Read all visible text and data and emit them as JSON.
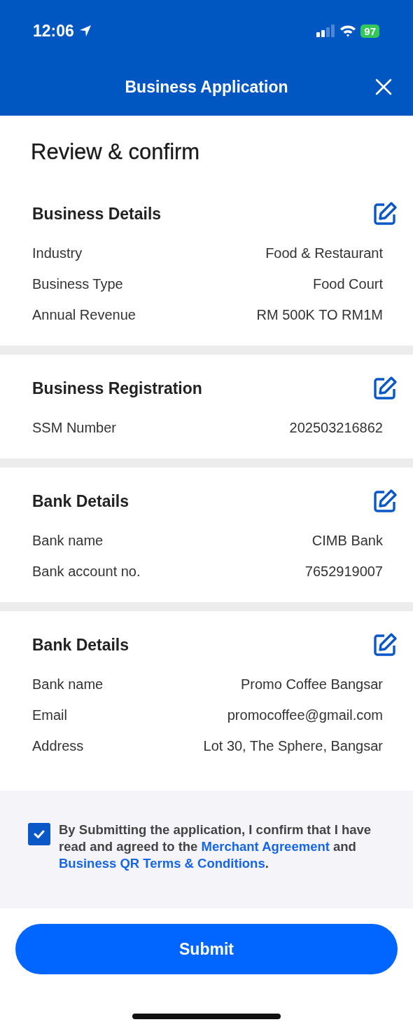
{
  "status_bar": {
    "time": "12:06",
    "battery": "97"
  },
  "header": {
    "title": "Business Application"
  },
  "page_title": "Review & confirm",
  "sections": [
    {
      "title": "Business Details",
      "rows": [
        {
          "label": "Industry",
          "value": "Food & Restaurant"
        },
        {
          "label": "Business Type",
          "value": "Food Court"
        },
        {
          "label": "Annual Revenue",
          "value": "RM 500K TO RM1M"
        }
      ]
    },
    {
      "title": "Business Registration",
      "rows": [
        {
          "label": "SSM Number",
          "value": "202503216862"
        }
      ]
    },
    {
      "title": "Bank Details",
      "rows": [
        {
          "label": "Bank name",
          "value": "CIMB Bank"
        },
        {
          "label": "Bank account no.",
          "value": "7652919007"
        }
      ]
    },
    {
      "title": "Bank Details",
      "rows": [
        {
          "label": "Bank name",
          "value": "Promo Coffee Bangsar"
        },
        {
          "label": "Email",
          "value": "promocoffee@gmail.com"
        },
        {
          "label": "Address",
          "value": "Lot 30, The Sphere, Bangsar"
        }
      ]
    }
  ],
  "consent": {
    "checked": true,
    "parts": [
      {
        "kind": "text",
        "text": "By Submitting the application, I confirm that I have read and agreed to the "
      },
      {
        "kind": "link",
        "text": "Merchant Agreement"
      },
      {
        "kind": "text",
        "text": " and "
      },
      {
        "kind": "link",
        "text": "Business QR Terms & Conditions"
      },
      {
        "kind": "text",
        "text": "."
      }
    ]
  },
  "submit_button": "Submit"
}
